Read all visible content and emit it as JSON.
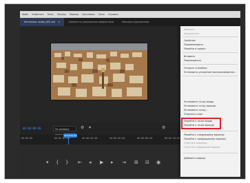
{
  "menubar": [
    "Файл",
    "Изменить",
    "Клип",
    "Эпизод",
    "Маркер",
    "Заголовок",
    "Окно",
    "Справка"
  ],
  "tabs": [
    {
      "label": "Источник: video_001.avi",
      "active": true
    },
    {
      "label": "Элементы управления эффектами",
      "active": false
    },
    {
      "label": "Микшер аудиоклипа",
      "active": false
    }
  ],
  "timecode_left": "00:00:00:00",
  "fit_select": "По размеру кадра",
  "timecode_right": "00:00:07:29",
  "playhead_label": "00:00:00:00",
  "ruler_ticks": [
    "00:00:00",
    "00:00:02:00",
    "00:00:04:00",
    "00:00:06:00",
    "00:00:08:00",
    "00:00:10:00"
  ],
  "context_menu": {
    "groups": [
      [
        "Закрыть",
        "Закрыть все"
      ],
      [
        "Свойства",
        "Переименовать",
        "Перейти в проект"
      ],
      [
        "Вставить",
        "Перезаписать"
      ],
      [
        "Открыть в Audition",
        "Установить ускорение воспроизведения..."
      ],
      [
        "Установить точку входа",
        "Установить точку выхода",
        "Установить точку...",
        "Отметить клип"
      ],
      [
        "Перейти к точке входа",
        "Перейти к точке выхода"
      ],
      [
        "Перейти к следующему маркеру",
        "Перейти к предыдущему маркеру",
        "Очистить маркеры",
        "Очистить выбранный маркер"
      ],
      [
        "Добавить маркер"
      ]
    ],
    "highlighted": [
      "Перейти к точке входа",
      "Перейти к точке выхода"
    ]
  },
  "colors": {
    "accent": "#2f8fff",
    "highlight_box": "#e0202a"
  }
}
